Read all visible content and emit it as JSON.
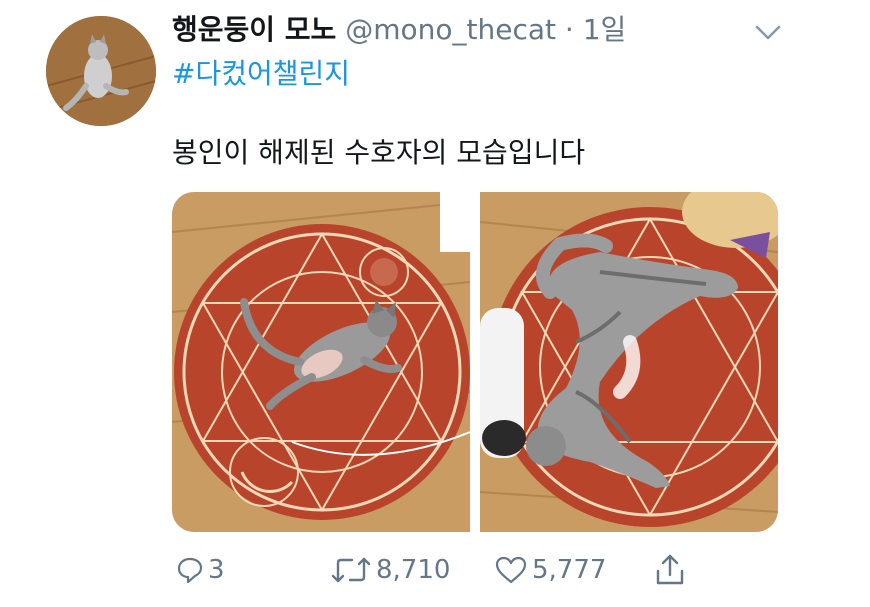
{
  "tweet": {
    "display_name": "행운둥이 모노",
    "handle": "@mono_thecat",
    "separator": "·",
    "time": "1일",
    "hashtag": "#다컸어챌린지",
    "text": "봉인이 해제된 수호자의 모습입니다"
  },
  "actions": {
    "reply_count": "3",
    "retweet_count": "8,710",
    "like_count": "5,777"
  },
  "icons": {
    "menu": "chevron-down-icon",
    "reply": "reply-icon",
    "retweet": "retweet-icon",
    "like": "heart-icon",
    "share": "share-icon"
  },
  "colors": {
    "link": "#1b95e0",
    "secondary": "#657786",
    "rug": "#b8442c",
    "rug_pattern": "#f2d8b5",
    "floor": "#c8a068"
  }
}
